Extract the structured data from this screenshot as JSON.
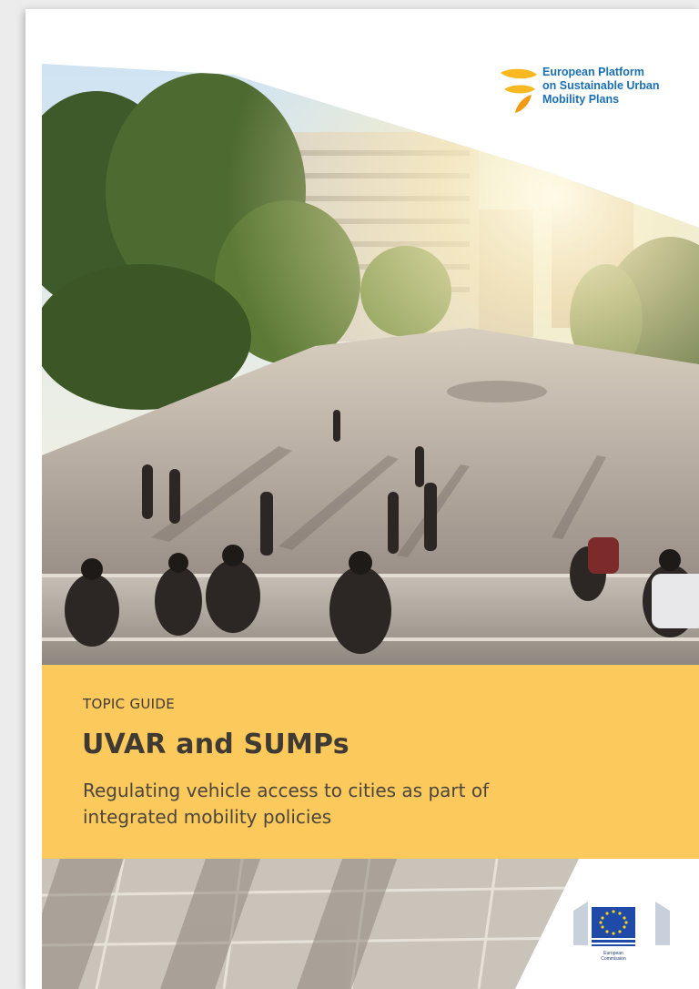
{
  "platform_logo": {
    "line1": "European Platform",
    "line2": "on Sustainable Urban",
    "line3": "Mobility Plans",
    "color": "#1a6fb5",
    "mark_color": "#f7b821"
  },
  "cover": {
    "kicker": "TOPIC GUIDE",
    "title": "UVAR and SUMPs",
    "subtitle_line1": "Regulating vehicle access to cities as part of",
    "subtitle_line2": "integrated mobility policies",
    "band_color": "#fcc95c"
  },
  "publisher_logo": {
    "name": "European Commission",
    "line1": "European",
    "line2": "Commission",
    "color": "#1f3a73"
  }
}
